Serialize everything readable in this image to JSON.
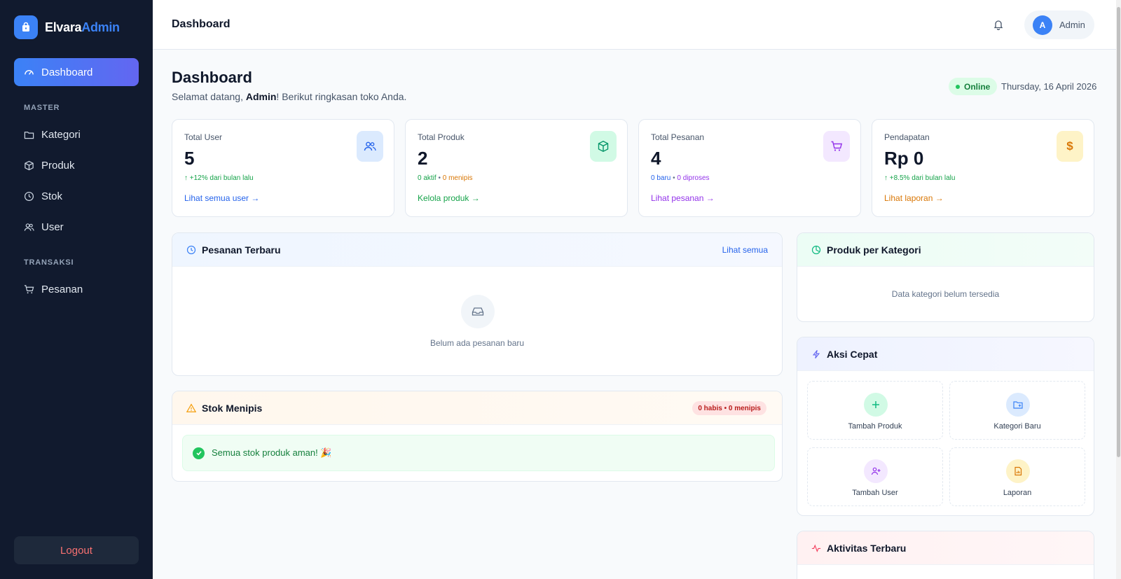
{
  "brand": {
    "name_part1": "Elvara",
    "name_part2": "Admin"
  },
  "sidebar": {
    "dashboard": "Dashboard",
    "section_master": "MASTER",
    "kategori": "Kategori",
    "produk": "Produk",
    "stok": "Stok",
    "user": "User",
    "section_transaksi": "TRANSAKSI",
    "pesanan": "Pesanan",
    "logout": "Logout"
  },
  "topbar": {
    "title": "Dashboard",
    "avatar_initial": "A",
    "user_name": "Admin"
  },
  "header": {
    "title": "Dashboard",
    "subtitle_prefix": "Selamat datang, ",
    "subtitle_name": "Admin",
    "subtitle_suffix": "! Berikut ringkasan toko Anda.",
    "status": "Online",
    "date": "Thursday, 16 April 2026"
  },
  "stats": {
    "users": {
      "label": "Total User",
      "value": "5",
      "sub": "+12% dari bulan lalu",
      "link": "Lihat semua user →"
    },
    "products": {
      "label": "Total Produk",
      "value": "2",
      "sub_active": "0 aktif",
      "sub_sep": " • ",
      "sub_low": "0 menipis",
      "link": "Kelola produk →"
    },
    "orders": {
      "label": "Total Pesanan",
      "value": "4",
      "sub_new": "0 baru",
      "sub_sep": " • ",
      "sub_process": "0 diproses",
      "link": "Lihat pesanan →"
    },
    "revenue": {
      "label": "Pendapatan",
      "value": "Rp 0",
      "sub": "+8.5% dari bulan lalu",
      "link": "Lihat laporan →"
    }
  },
  "recent_orders": {
    "title": "Pesanan Terbaru",
    "link": "Lihat semua",
    "empty": "Belum ada pesanan baru"
  },
  "low_stock": {
    "title": "Stok Menipis",
    "badge": "0 habis • 0 menipis",
    "ok_message": "Semua stok produk aman! 🎉"
  },
  "category_panel": {
    "title": "Produk per Kategori",
    "empty": "Data kategori belum tersedia"
  },
  "quick_actions": {
    "title": "Aksi Cepat",
    "add_product": "Tambah Produk",
    "new_category": "Kategori Baru",
    "add_user": "Tambah User",
    "report": "Laporan"
  },
  "activity": {
    "title": "Aktivitas Terbaru"
  },
  "colors": {
    "accent": "#3b82f6",
    "sidebar_bg": "#111a2e",
    "green": "#16a34a",
    "purple": "#9333ea",
    "orange": "#d97706",
    "red": "#dc2626"
  }
}
